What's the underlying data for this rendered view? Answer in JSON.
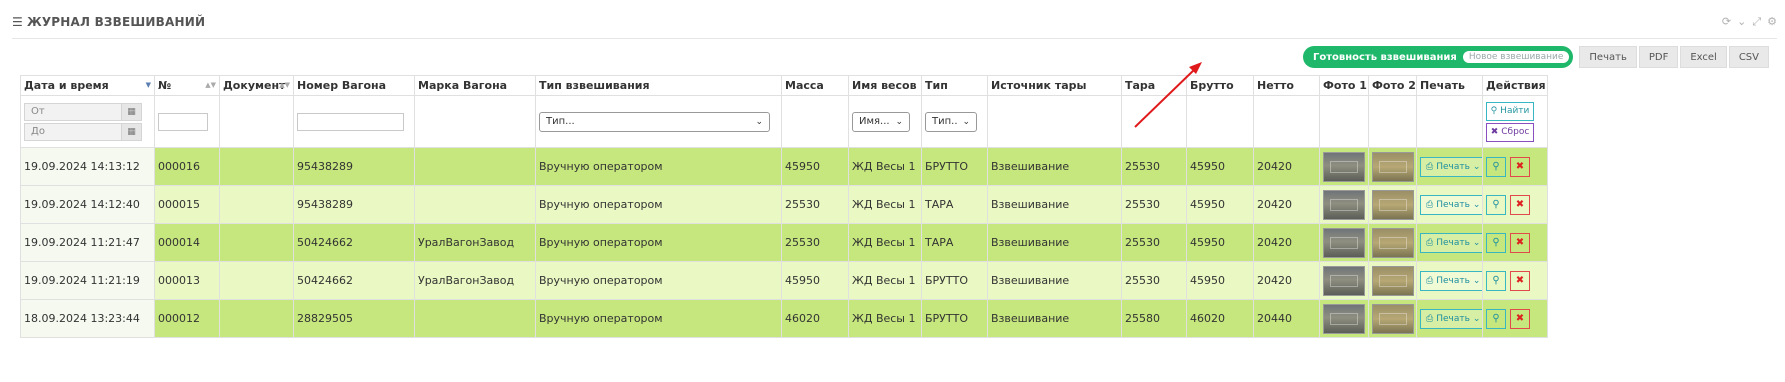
{
  "panel": {
    "title": "ЖУРНАЛ ВЗВЕШИВАНИЙ",
    "tools": [
      "refresh-icon",
      "chevron-down-icon",
      "expand-icon",
      "gear-icon"
    ]
  },
  "toolbar": {
    "ready_label": "Готовность взвешивания",
    "ready_status": "Новое взвешивание",
    "print": "Печать",
    "pdf": "PDF",
    "excel": "Excel",
    "csv": "CSV"
  },
  "columns": [
    "Дата и время",
    "№",
    "Документ",
    "Номер Вагона",
    "Марка Вагона",
    "Тип взвешивания",
    "Масса",
    "Имя весов",
    "Тип",
    "Источник тары",
    "Тара",
    "Брутто",
    "Нетто",
    "Фото 1",
    "Фото 2",
    "Печать",
    "Действия"
  ],
  "filters": {
    "date_from": "От",
    "date_to": "До",
    "weigh_type": "Тип...",
    "scale_name": "Имя...",
    "type": "Тип..",
    "find": "Найти",
    "reset": "Сброс"
  },
  "rows": [
    {
      "datetime": "19.09.2024 14:13:12",
      "num": "000016",
      "doc": "",
      "wagon_no": "95438289",
      "wagon_brand": "",
      "weigh_type": "Вручную оператором",
      "mass": "45950",
      "scale": "ЖД Весы 1",
      "type": "БРУТТО",
      "tare_source": "Взвешивание",
      "tare": "25530",
      "gross": "45950",
      "net": "20420",
      "print": "Печать"
    },
    {
      "datetime": "19.09.2024 14:12:40",
      "num": "000015",
      "doc": "",
      "wagon_no": "95438289",
      "wagon_brand": "",
      "weigh_type": "Вручную оператором",
      "mass": "25530",
      "scale": "ЖД Весы 1",
      "type": "ТАРА",
      "tare_source": "Взвешивание",
      "tare": "25530",
      "gross": "45950",
      "net": "20420",
      "print": "Печать"
    },
    {
      "datetime": "19.09.2024 11:21:47",
      "num": "000014",
      "doc": "",
      "wagon_no": "50424662",
      "wagon_brand": "УралВагонЗавод",
      "weigh_type": "Вручную оператором",
      "mass": "25530",
      "scale": "ЖД Весы 1",
      "type": "ТАРА",
      "tare_source": "Взвешивание",
      "tare": "25530",
      "gross": "45950",
      "net": "20420",
      "print": "Печать"
    },
    {
      "datetime": "19.09.2024 11:21:19",
      "num": "000013",
      "doc": "",
      "wagon_no": "50424662",
      "wagon_brand": "УралВагонЗавод",
      "weigh_type": "Вручную оператором",
      "mass": "45950",
      "scale": "ЖД Весы 1",
      "type": "БРУТТО",
      "tare_source": "Взвешивание",
      "tare": "25530",
      "gross": "45950",
      "net": "20420",
      "print": "Печать"
    },
    {
      "datetime": "18.09.2024 13:23:44",
      "num": "000012",
      "doc": "",
      "wagon_no": "28829505",
      "wagon_brand": "",
      "weigh_type": "Вручную оператором",
      "mass": "46020",
      "scale": "ЖД Весы 1",
      "type": "БРУТТО",
      "tare_source": "Взвешивание",
      "tare": "25580",
      "gross": "46020",
      "net": "20440",
      "print": "Печать"
    }
  ],
  "colors": {
    "row_dark": "#c6e77e",
    "row_light": "#eaf8c3",
    "ready_pill": "#1fb86b",
    "arrow": "#e0191b"
  }
}
